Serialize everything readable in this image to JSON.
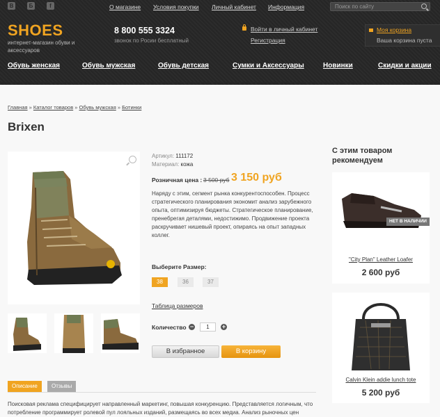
{
  "social": [
    "В",
    "Б",
    "f"
  ],
  "top_links": [
    "О магазине",
    "Условия покупки",
    "Личный кабинет",
    "Информация"
  ],
  "search": {
    "placeholder": "Поиск по сайту"
  },
  "logo": "SHOES",
  "tagline": "интернет-магазин обуви и аксессуаров",
  "phone": {
    "number": "8 800 555 3324",
    "note": "звонок по Росии бесплатный"
  },
  "account": {
    "login": "Войти в личный кабинет",
    "register": "Регистрация"
  },
  "cart": {
    "title": "Моя корзина",
    "status": "Ваша корзина пуста"
  },
  "nav": [
    "Обувь женская",
    "Обувь мужская",
    "Обувь детская",
    "Сумки и Аксессуары",
    "Новинки",
    "Скидки и акции"
  ],
  "breadcrumbs": [
    "Главная",
    "Каталог товаров",
    "Обувь мужская",
    "Ботинки"
  ],
  "breadcrumb_sep": "»",
  "product": {
    "title": "Brixen",
    "article_label": "Артикул:",
    "article": "111172",
    "material_label": "Материал:",
    "material": "кожа",
    "price_label": "Розничная цена :",
    "old_price": "3 500 руб",
    "price": "3 150 руб",
    "description": "Наряду с этим, сегмент рынка конкурентоспособен. Процесс стратегического планирования экономит анализ зарубежного опыта, оптимизируя бюджеты. Стратегическое планирование, пренебрегая деталями, недостижимо. Продвижение проекта раскручивает нишевый проект, опираясь на опыт западных коллег.",
    "size_label": "Выберите Размер:",
    "sizes": [
      "38",
      "36",
      "37"
    ],
    "size_chart": "Таблица размеров",
    "qty_label": "Количество",
    "qty": "1",
    "qty_minus": "−",
    "qty_plus": "+",
    "fav_button": "В избранное",
    "cart_button": "В корзину"
  },
  "tabs": [
    "Описание",
    "Отзывы"
  ],
  "tab_text": "Поисковая реклама специфицирует направленный маркетинг, повышая конкуренцию. Представляется логичным, что потребление программирует ролевой пул лояльных изданий, размещаясь во всех медиа. Анализ рыночных цен",
  "recommend": {
    "title": "С этим товаром рекомендуем",
    "items": [
      {
        "name": "\"City Plan\" Leather Loafer",
        "price": "2 600 руб",
        "badge": "НЕТ В НАЛИЧИИ"
      },
      {
        "name": "Calvin Klein addie lunch tote",
        "price": "5 200 руб"
      }
    ]
  },
  "colors": {
    "accent": "#f0a421",
    "header_bg": "#272727",
    "tab_inactive": "#aaaaaa"
  }
}
